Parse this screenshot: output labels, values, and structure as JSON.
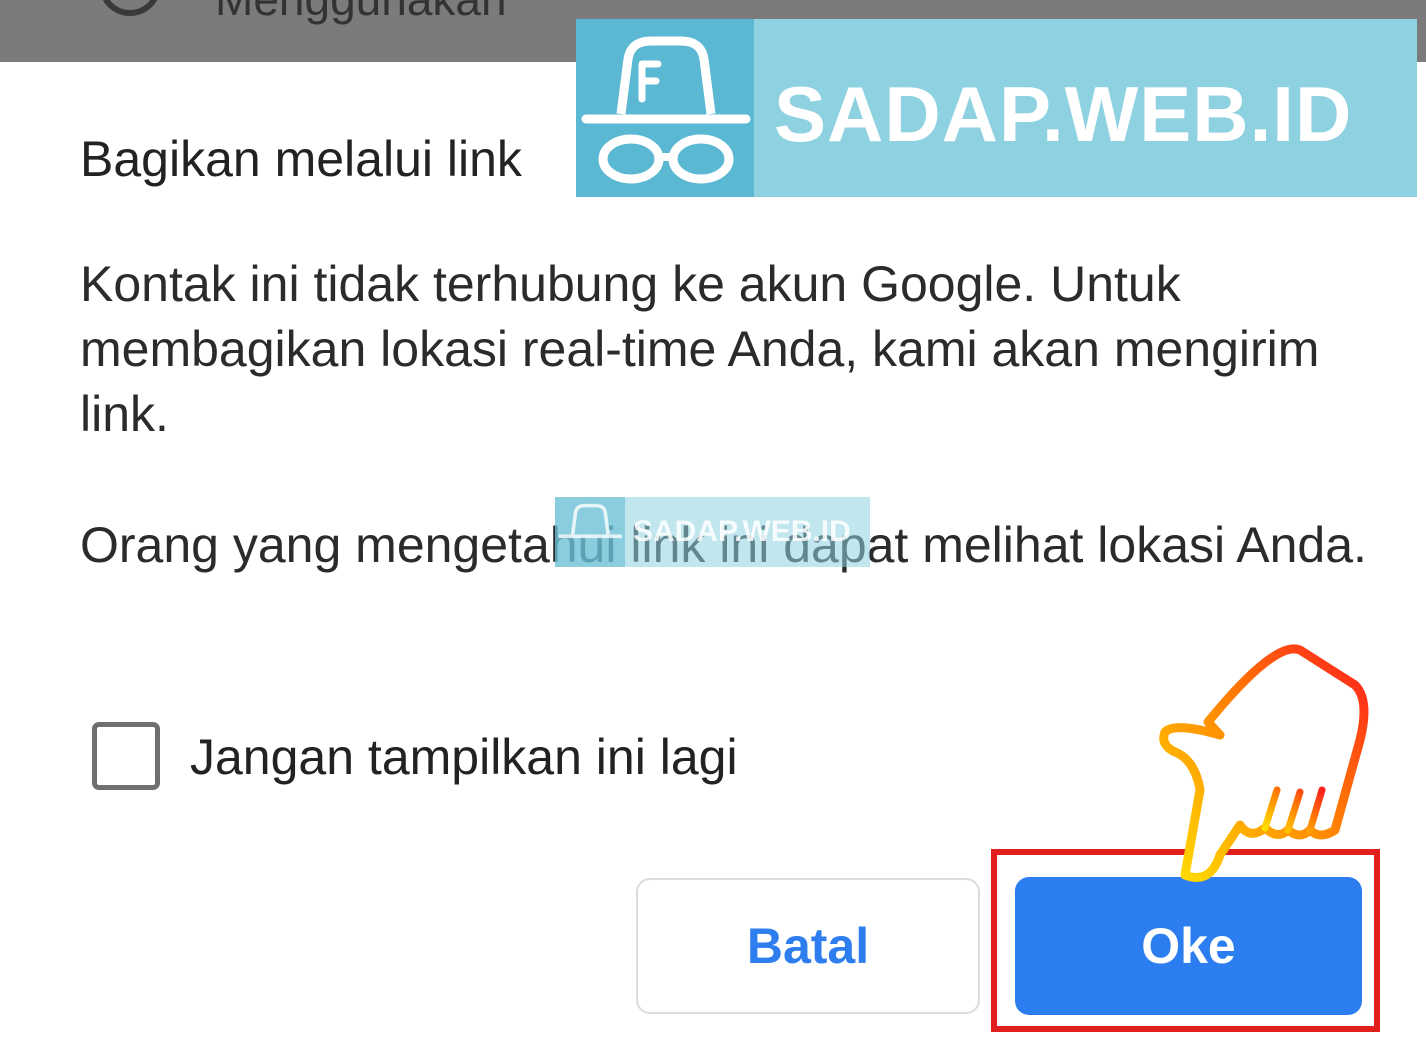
{
  "top_strip": {
    "partial_text": "Menggunakan"
  },
  "dialog": {
    "title": "Bagikan melalui link",
    "paragraph_1": "Kontak ini tidak terhubung ke akun Google. Untuk membagikan lokasi real-time Anda, kami akan mengirim link.",
    "paragraph_2": "Orang yang mengetahui link ini dapat melihat lokasi Anda.",
    "checkbox_label": "Jangan tampilkan ini lagi",
    "checkbox_checked": false,
    "cancel_label": "Batal",
    "ok_label": "Oke"
  },
  "watermark": {
    "text": "SADAP.WEB.ID",
    "small_text": "SADAP.WEB.ID"
  },
  "colors": {
    "primary_blue": "#2c7ef0",
    "highlight_red": "#e21f1f",
    "watermark_bg": "#8ed1e0",
    "watermark_icon_bg": "#5bb8d3",
    "top_strip_gray": "#7b7b7b"
  },
  "icons": {
    "watermark_logo": "spy-hat-glasses-icon",
    "pointer": "pointing-hand-icon"
  }
}
